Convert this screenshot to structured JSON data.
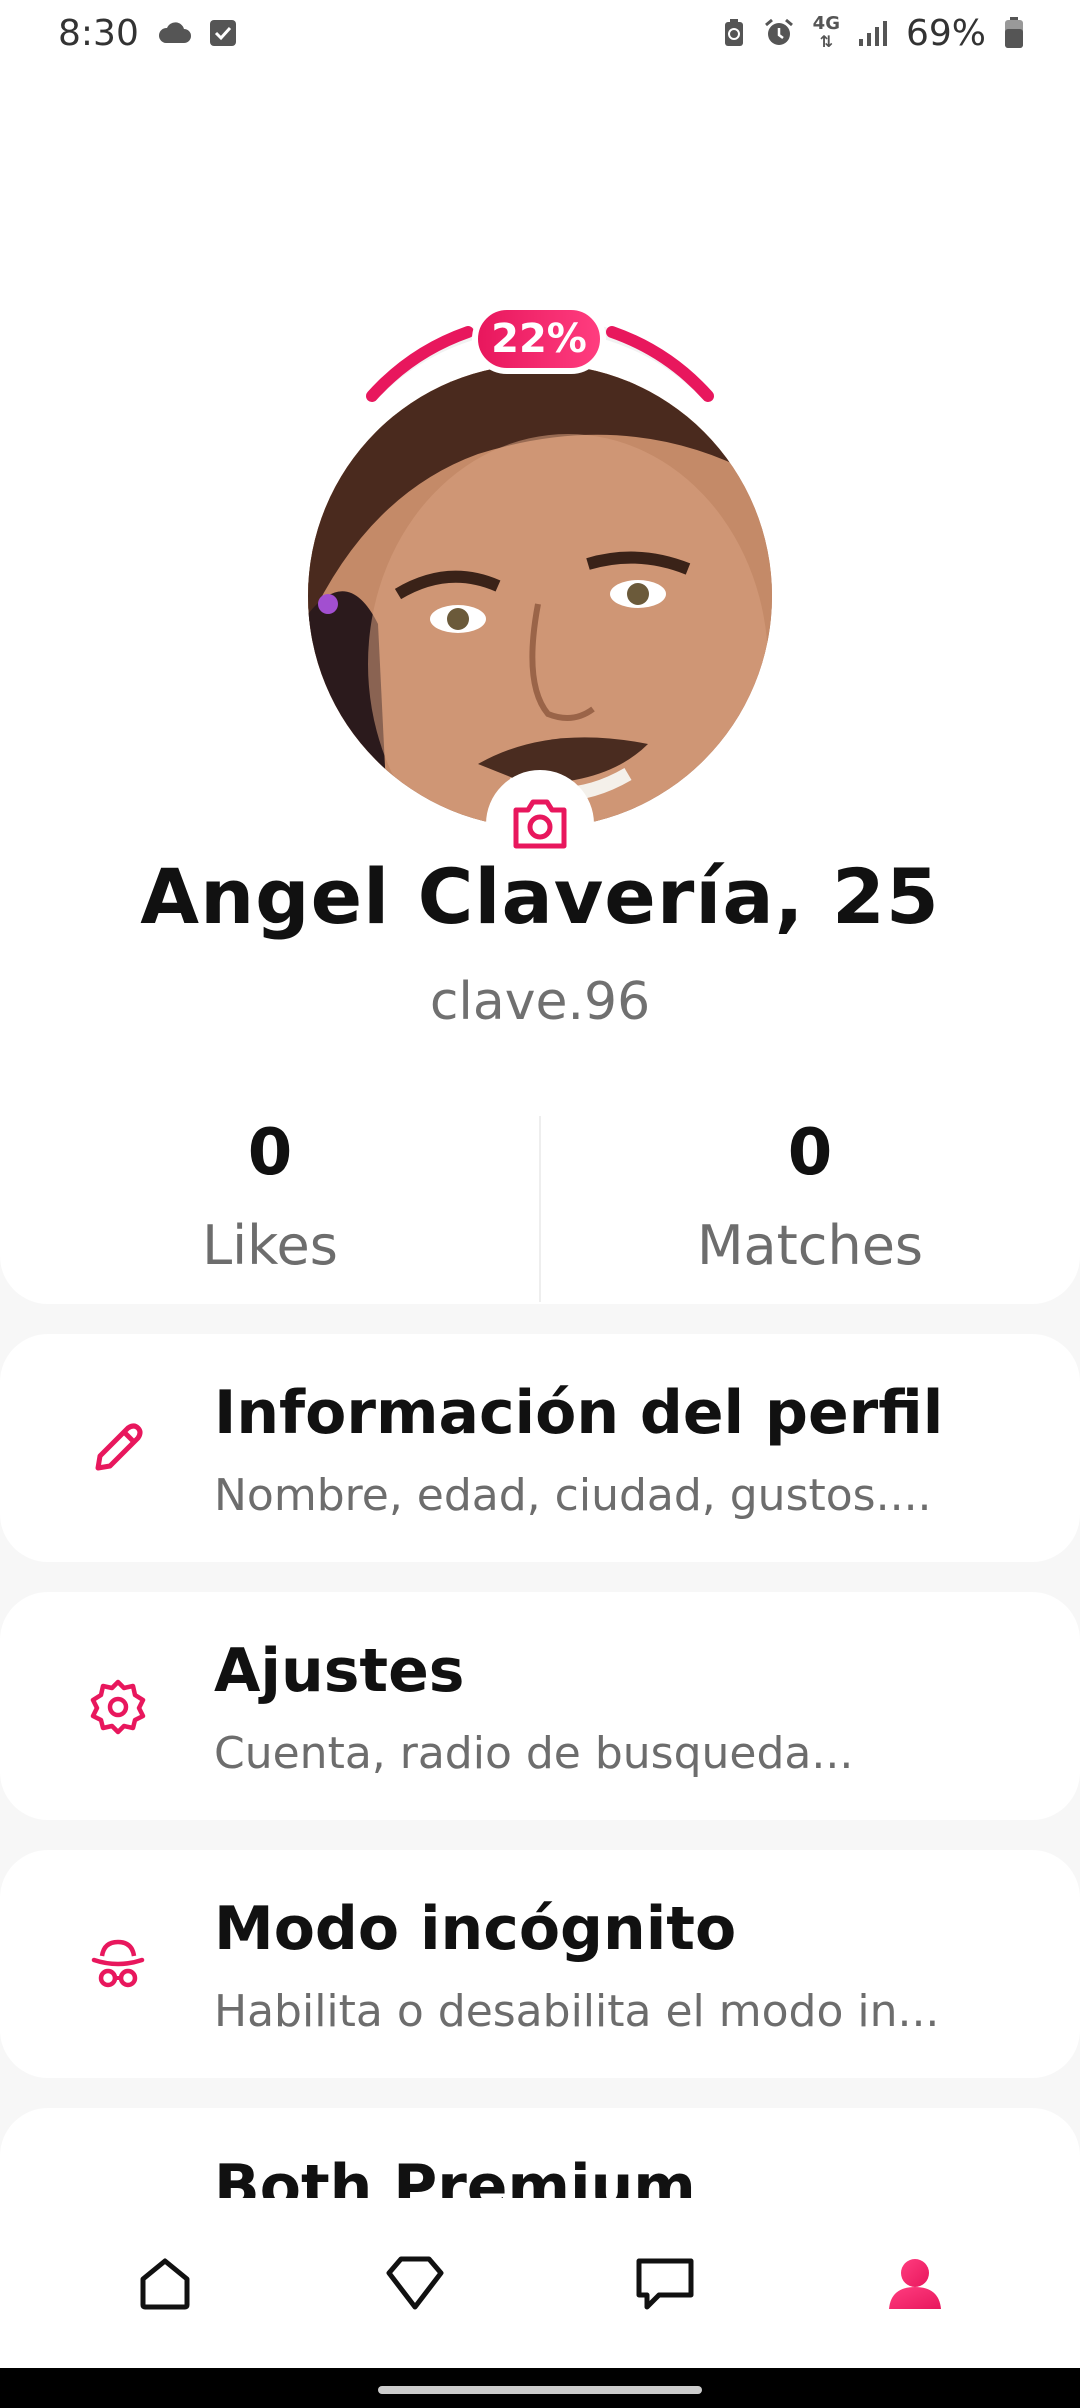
{
  "status_bar": {
    "time": "8:30",
    "battery": "69%",
    "network": "4G"
  },
  "profile": {
    "completion": "22%",
    "completion_value": 22,
    "name": "Angel Clavería, 25",
    "username": "clave.96"
  },
  "stats": {
    "likes_value": "0",
    "likes_label": "Likes",
    "matches_value": "0",
    "matches_label": "Matches"
  },
  "menu": {
    "items": [
      {
        "title": "Información del perfil",
        "subtitle": "Nombre, edad, ciudad, gustos....",
        "icon": "pencil-icon"
      },
      {
        "title": "Ajustes",
        "subtitle": "Cuenta, radio de busqueda...",
        "icon": "gear-icon"
      },
      {
        "title": "Modo incógnito",
        "subtitle": "Habilita o desabilita el modo in...",
        "icon": "incognito-icon"
      },
      {
        "title": "Both Premium",
        "subtitle": "",
        "icon": "premium-icon"
      }
    ]
  },
  "nav": {
    "items": [
      "home-icon",
      "diamond-icon",
      "chat-icon",
      "profile-icon"
    ],
    "active": "profile-icon"
  },
  "colors": {
    "accent": "#e8175d",
    "accent_light": "#ff3d7f",
    "muted_text": "#6d6d6d",
    "premium": "#f0b429"
  }
}
